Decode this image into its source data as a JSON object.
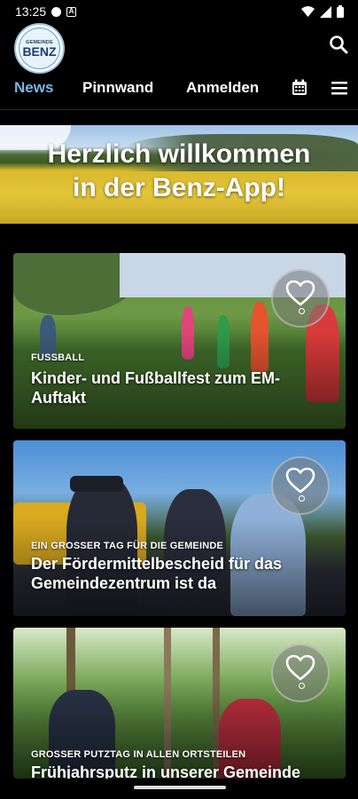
{
  "status_bar": {
    "time": "13:25"
  },
  "logo": {
    "top_text": "GEMEINDE",
    "main_text": "BENZ"
  },
  "nav": {
    "news": "News",
    "pinnwand": "Pinnwand",
    "anmelden": "Anmelden"
  },
  "hero": {
    "line1": "Herzlich willkommen",
    "line2": "in der Benz-App!"
  },
  "cards": [
    {
      "category": "Fußball",
      "title": "Kinder- und Fußballfest zum EM-Auftakt"
    },
    {
      "category": "Ein großer Tag für die Gemeinde",
      "title": "Der Fördermittelbescheid für das Gemeindezentrum ist da"
    },
    {
      "category": "Großer Putztag in allen Ortsteilen",
      "title": "Frühjahrsputz in unserer Gemeinde"
    }
  ],
  "colors": {
    "accent": "#7bb6e6",
    "background": "#000000"
  }
}
